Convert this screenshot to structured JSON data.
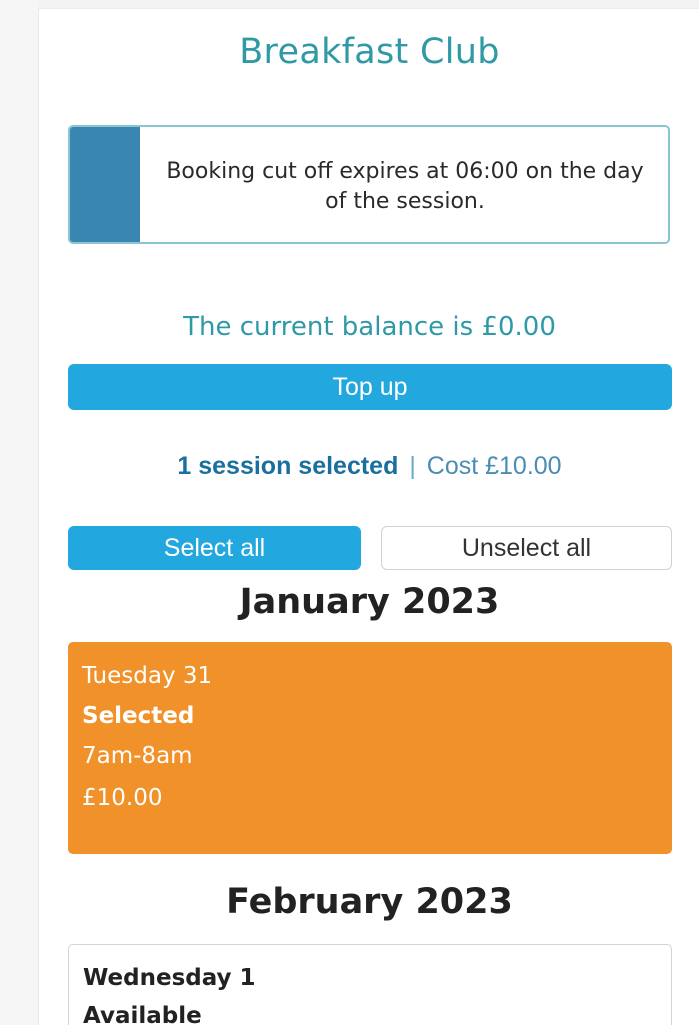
{
  "page": {
    "title": "Breakfast Club"
  },
  "info_panel": {
    "message": "Booking cut off expires at 06:00 on the day of the session."
  },
  "balance": {
    "text": "The current balance is £0.00"
  },
  "topup_button": {
    "label": "Top up"
  },
  "selection_summary": {
    "count_text": "1 session selected",
    "divider": "|",
    "cost_text": "Cost £10.00"
  },
  "select_all_button": {
    "label": "Select all"
  },
  "unselect_all_button": {
    "label": "Unselect all"
  },
  "months": [
    {
      "heading": "January 2023",
      "sessions": [
        {
          "day": "Tuesday 31",
          "status": "Selected",
          "time": "7am-8am",
          "price": "£10.00"
        }
      ]
    },
    {
      "heading": "February 2023",
      "sessions": [
        {
          "day": "Wednesday 1",
          "status": "Available"
        }
      ]
    }
  ],
  "colors": {
    "accent_teal": "#2f9aa6",
    "primary_blue": "#23a7df",
    "selected_orange": "#f0912a",
    "info_accent": "#3a86b3"
  }
}
